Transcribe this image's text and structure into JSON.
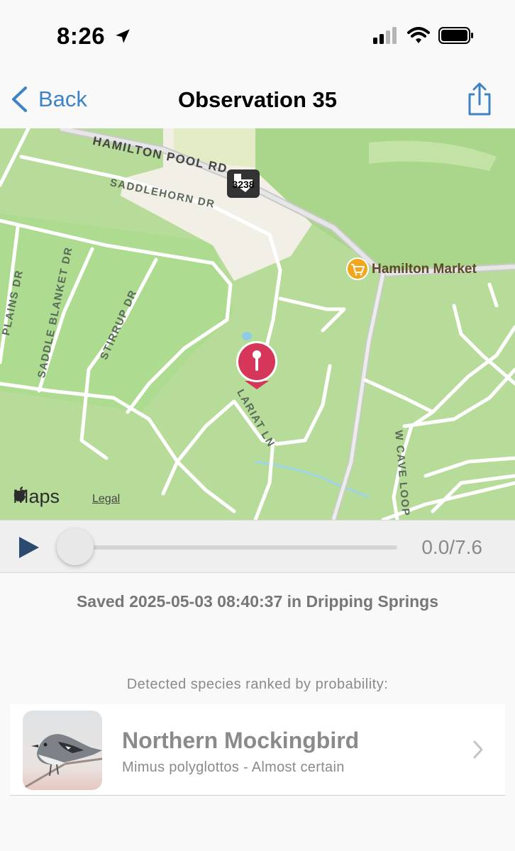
{
  "status_bar": {
    "time": "8:26"
  },
  "nav": {
    "back_label": "Back",
    "title": "Observation 35"
  },
  "map": {
    "road_labels": [
      "HAMILTON POOL RD",
      "SADDLEHORN DR",
      "PLAINS DR",
      "SADDLE BLANKET DR",
      "STIRRUP DR",
      "LARIAT LN",
      "W CAVE LOOP"
    ],
    "route_shield": "3238",
    "poi": "Hamilton Market",
    "attribution": "Maps",
    "legal": "Legal"
  },
  "player": {
    "time": "0.0/7.6",
    "progress": 0.0
  },
  "saved": "Saved 2025-05-03 08:40:37 in Dripping Springs",
  "detected_header": "Detected species ranked by probability:",
  "species": [
    {
      "common_name": "Northern Mockingbird",
      "detail": "Mimus polyglottos - Almost certain"
    }
  ],
  "colors": {
    "accent": "#3f83c4",
    "map_green": "#b7dc99",
    "pin": "#d6365a"
  }
}
